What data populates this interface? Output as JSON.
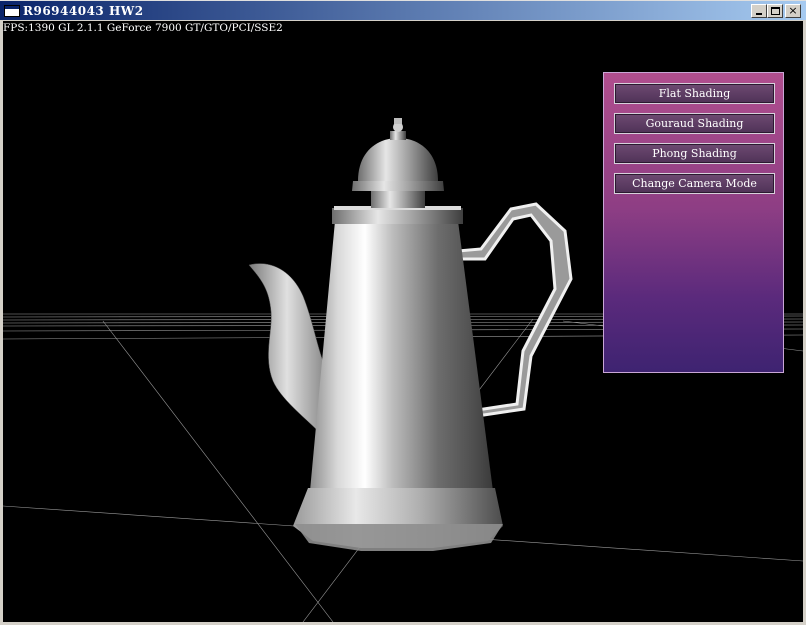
{
  "window": {
    "title": "R96944043 HW2",
    "minimize_label": "",
    "maximize_label": "",
    "close_label": "×"
  },
  "overlay": {
    "fps_text": "FPS:1390 GL 2.1.1 GeForce 7900 GT/GTO/PCI/SSE2"
  },
  "panel": {
    "buttons": [
      {
        "label": "Flat Shading"
      },
      {
        "label": "Gouraud Shading"
      },
      {
        "label": "Phong Shading"
      },
      {
        "label": "Change Camera Mode"
      }
    ]
  },
  "scene": {
    "background_color": "#000000",
    "object": "teapot",
    "grid_color": "#cfcfcf"
  }
}
